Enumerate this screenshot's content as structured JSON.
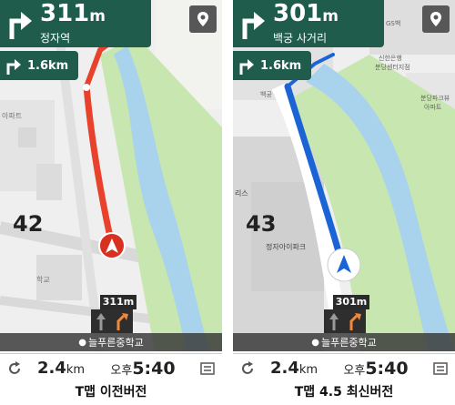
{
  "left_screen": {
    "turn": {
      "distance": "311",
      "unit": "m",
      "place": "정자역"
    },
    "next_turn": {
      "distance": "1.6km"
    },
    "speed_limit": "42",
    "remaining_to_turn": "311m",
    "destination": "늘푸른중학교",
    "bottom": {
      "remaining": "2.4",
      "remaining_unit": "km",
      "eta_prefix": "오후",
      "eta": "5:40"
    },
    "caption": "T맵 이전버전",
    "route_color": "#e8412c",
    "map_labels": {
      "apt": "아파트",
      "school": "학교"
    }
  },
  "right_screen": {
    "turn": {
      "distance": "301",
      "unit": "m",
      "place": "백궁 사거리"
    },
    "next_turn": {
      "distance": "1.6km"
    },
    "speed_limit": "43",
    "remaining_to_turn": "301m",
    "destination": "늘푸른중학교",
    "bottom": {
      "remaining": "2.4",
      "remaining_unit": "km",
      "eta_prefix": "오후",
      "eta": "5:40"
    },
    "caption": "T맵 4.5 최신버전",
    "route_color": "#1a64d6",
    "map_labels": {
      "shinhan": "신한은행",
      "bundang_branch": "분당센터지점",
      "gs": "GS백",
      "bundang_gs": "분당",
      "techno_apt": "분당파크뷰",
      "apt": "아파트",
      "baekgung": "백궁",
      "jeongja_ipark": "정자아이파크",
      "leeds": "리스"
    }
  },
  "colors": {
    "nav_green": "#1f5c4c",
    "river_blue": "#a9d3ec",
    "park_green": "#c8e6b0",
    "road_gray": "#e5e5e5"
  }
}
